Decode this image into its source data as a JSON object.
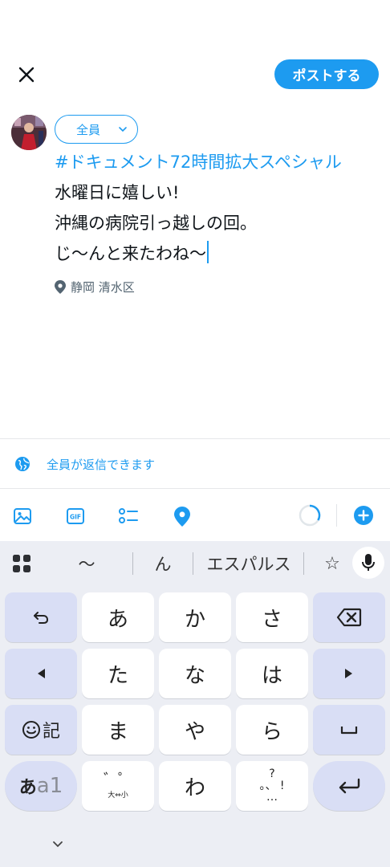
{
  "compose": {
    "post_label": "ポストする",
    "audience_label": "全員",
    "hashtag": "#ドキュメント72時間拡大スペシャル",
    "lines": [
      "水曜日に嬉しい!",
      "沖縄の病院引っ越しの回。",
      "じ〜んと来たわね〜"
    ],
    "location": "静岡 清水区",
    "reply_setting": "全員が返信できます"
  },
  "toolbar": {
    "icons": [
      "image-icon",
      "gif-icon",
      "poll-icon",
      "location-icon",
      "character-counter",
      "add-post-icon"
    ],
    "gif_text": "GIF"
  },
  "keyboard": {
    "suggestions": [
      "〜",
      "ん",
      "エスパルス"
    ],
    "star": "☆",
    "rows": [
      [
        "あ",
        "か",
        "さ"
      ],
      [
        "た",
        "な",
        "は"
      ],
      [
        "ま",
        "や",
        "ら"
      ],
      [
        "",
        "わ",
        ""
      ]
    ],
    "emoji_label": "記",
    "mode_label_a": "あ",
    "mode_label_b": "a1",
    "dakuten_main": "゛゜",
    "dakuten_sub": "大⇔小",
    "punct_top": "?",
    "punct_mid": "。、 !",
    "punct_bottom": "…"
  },
  "colors": {
    "accent": "#1d9bf0",
    "keyboard_bg": "#eceef4",
    "fn_key": "#d9def5"
  }
}
